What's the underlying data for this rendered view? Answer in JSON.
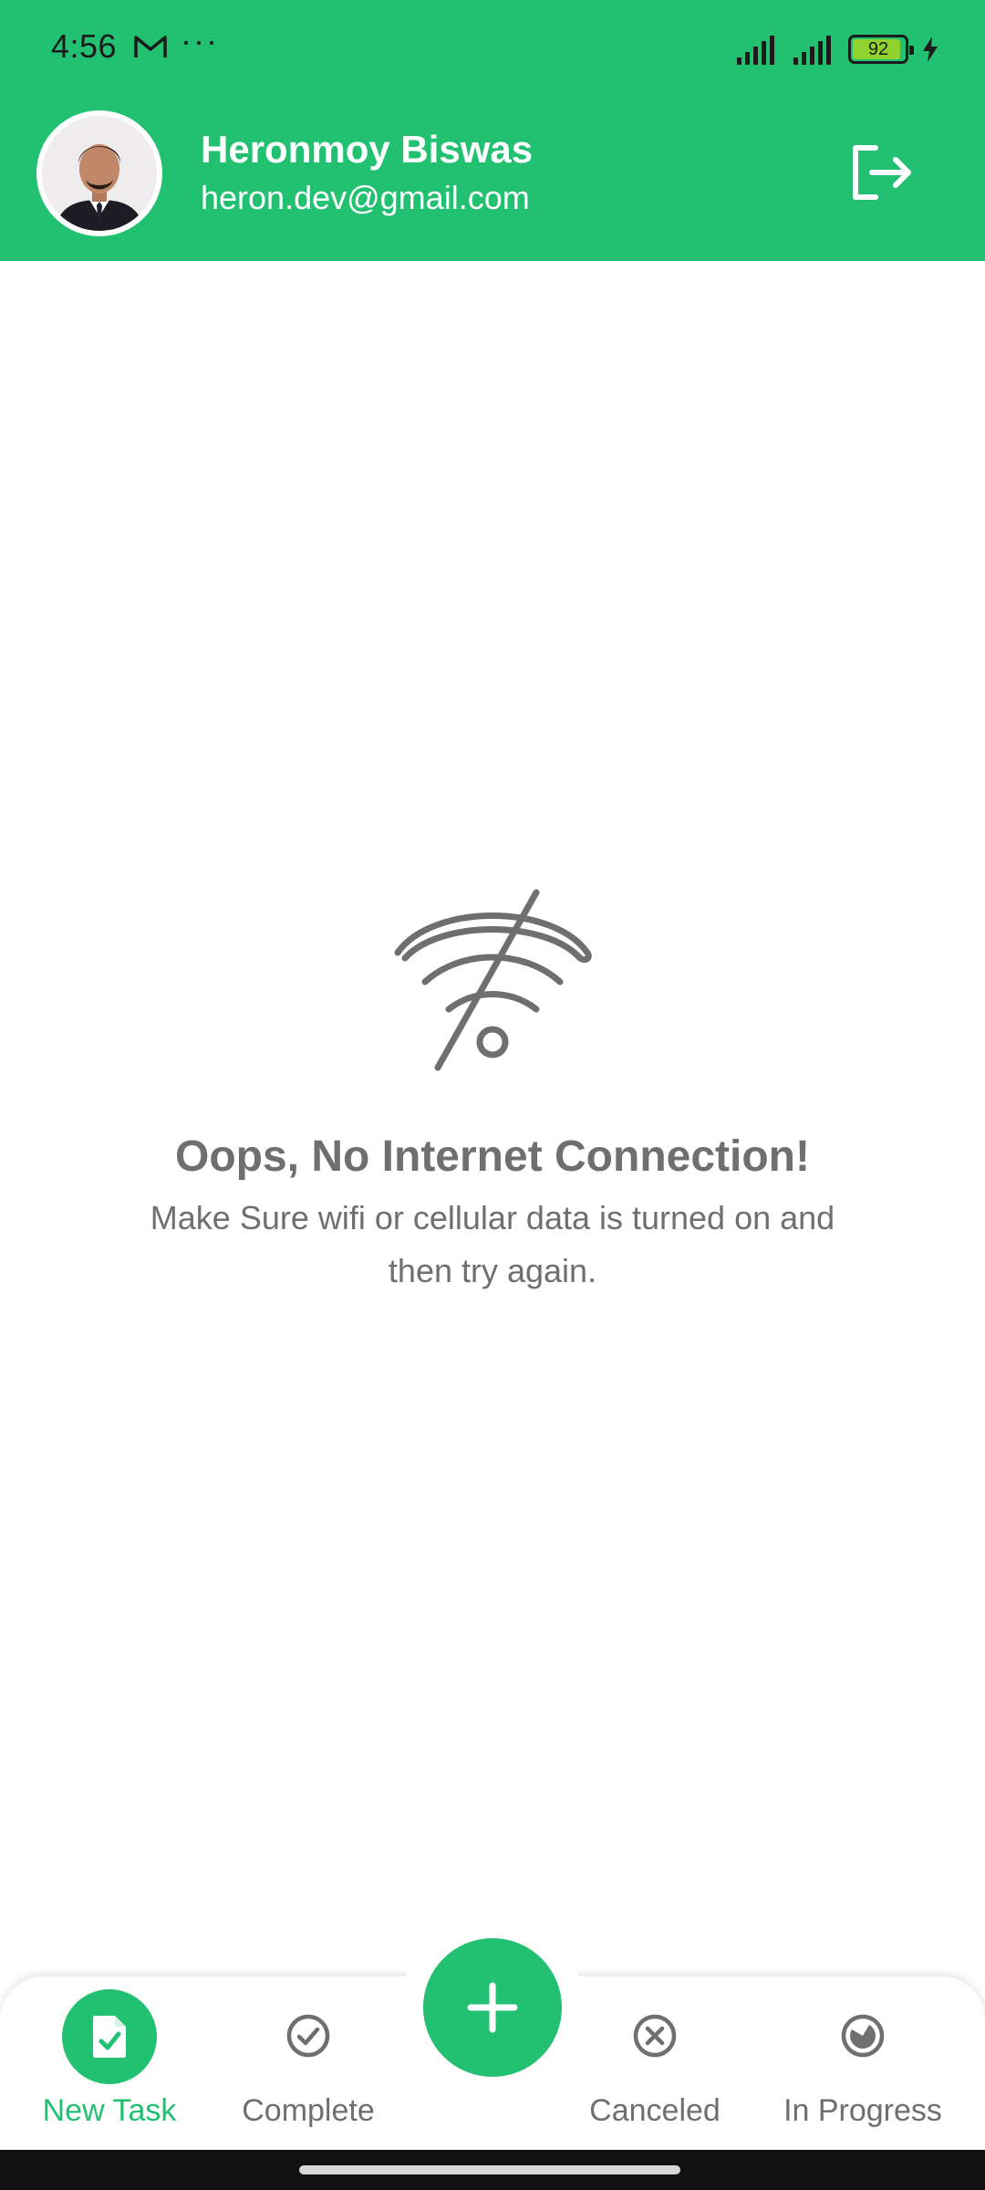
{
  "status_bar": {
    "time": "4:56",
    "more": "···",
    "battery_level": 92,
    "battery_text": "92",
    "icons": [
      "gmail-icon",
      "signal-icon",
      "signal-icon",
      "battery-icon",
      "charging-bolt-icon"
    ]
  },
  "header": {
    "user_name": "Heronmoy Biswas",
    "user_email": "heron.dev@gmail.com",
    "avatar_icon": "profile-photo",
    "logout_icon": "logout-icon"
  },
  "empty_state": {
    "icon": "wifi-off-icon",
    "title": "Oops, No Internet Connection!",
    "message": "Make Sure wifi or cellular data is turned on and then try again."
  },
  "bottom_nav": {
    "items": [
      {
        "label": "New Task",
        "icon": "task-document-check-icon",
        "active": true
      },
      {
        "label": "Complete",
        "icon": "check-circle-icon",
        "active": false
      },
      {
        "label": "Canceled",
        "icon": "cancel-circle-icon",
        "active": false
      },
      {
        "label": "In Progress",
        "icon": "progress-pie-icon",
        "active": false
      }
    ],
    "fab_icon": "plus-icon"
  },
  "colors": {
    "primary": "#22c172",
    "text_muted": "#6f6f6f",
    "status_text": "#1b1b1b",
    "background": "#ffffff"
  }
}
